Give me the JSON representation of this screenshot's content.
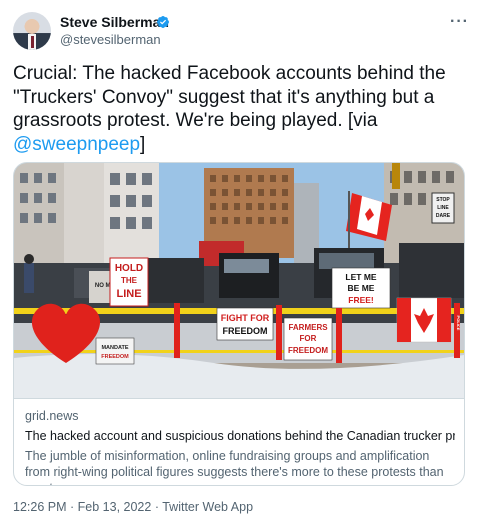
{
  "author": {
    "name": "Steve Silberman",
    "handle": "@stevesilberman"
  },
  "tweet": {
    "text_before_mention": "Crucial: The hacked Facebook accounts behind the \"Truckers' Convoy\" suggest that it's anything but a grassroots protest. We're being played. [via ",
    "mention": "@sweepnpeep",
    "text_after_mention": "]"
  },
  "card": {
    "domain": "grid.news",
    "title": "The hacked account and suspicious donations behind the Canadian trucker pr...",
    "description": "The jumble of misinformation, online fundraising groups and amplification from right-wing political figures suggests there's more to these protests than meets ...",
    "image_signs": {
      "hold_line_1": "HOLD",
      "hold_line_2": "THE",
      "hold_line_3": "LINE",
      "let_me_1": "LET ME",
      "let_me_2": "BE ME",
      "let_me_3": "FREE!",
      "fight_1": "FIGHT FOR",
      "fight_2": "FREEDOM",
      "farmers_1": "FARMERS",
      "farmers_2": "FOR",
      "farmers_3": "FREEDOM",
      "mandate_1": "MANDATE",
      "mandate_2": "FREEDOM",
      "no_mandate": "NO MANDATE",
      "stop_sign_1": "STOP",
      "stop_sign_2": "LINE",
      "stop_sign_3": "DARE",
      "police": "POLICE"
    }
  },
  "footer": {
    "time": "12:26 PM",
    "separator": "·",
    "date": "Feb 13, 2022",
    "source": "Twitter Web App"
  },
  "colors": {
    "link": "#1d9bf0",
    "secondary_text": "#536471",
    "verified": "#1d9bf0"
  },
  "icons": [
    "verified-badge-icon",
    "more-options-icon"
  ]
}
